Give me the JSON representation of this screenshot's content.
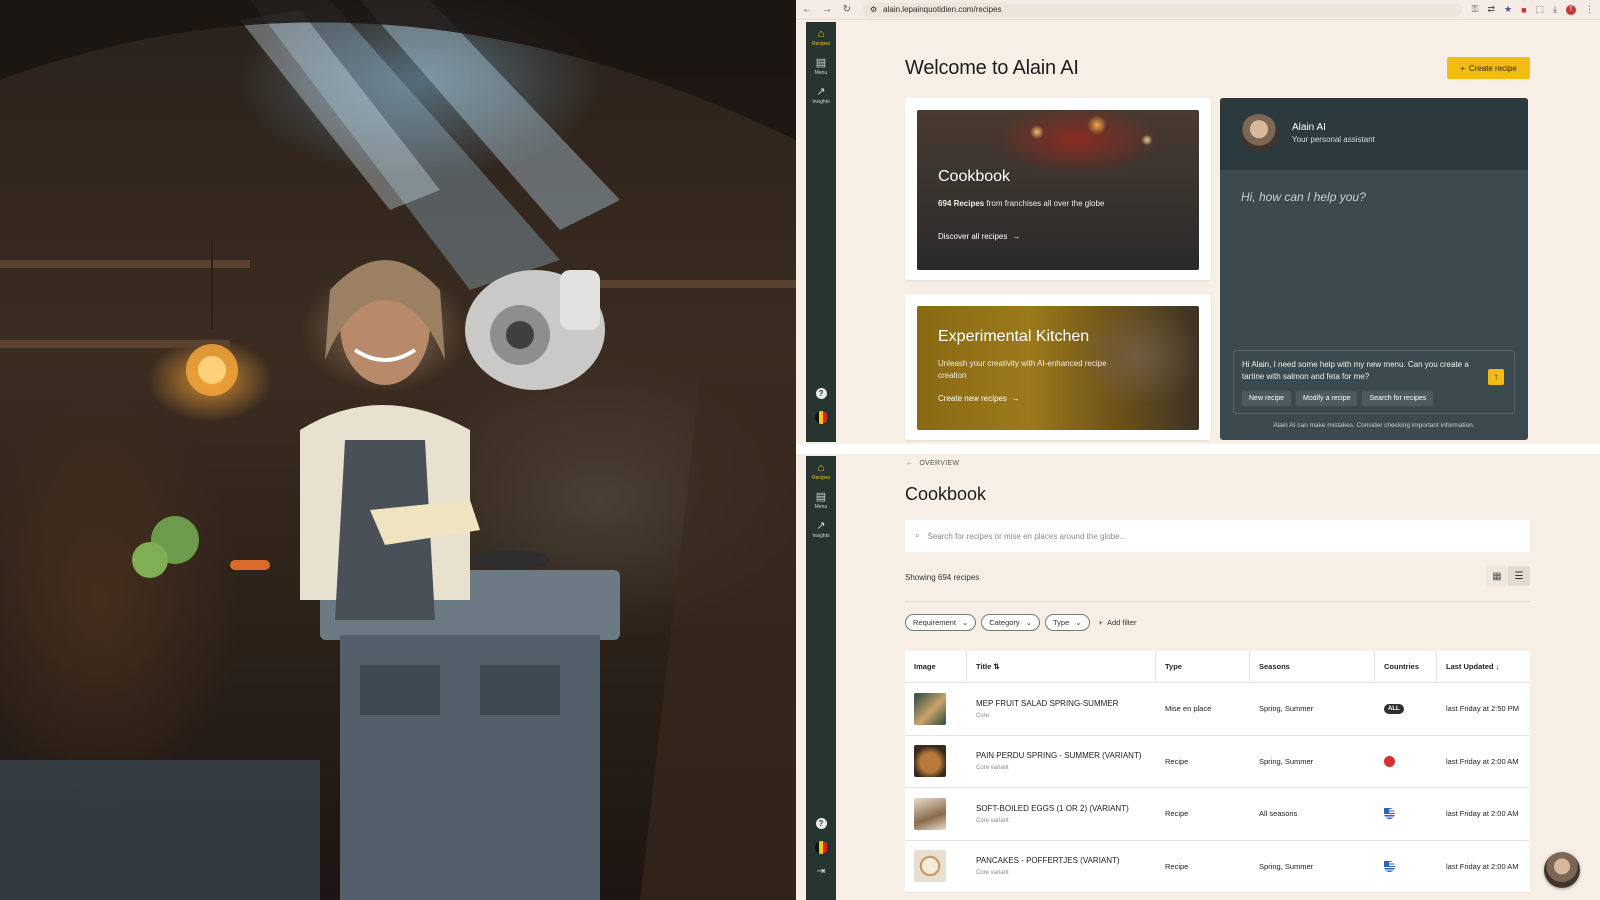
{
  "browser": {
    "url": "alain.lepainquotidien.com/recipes",
    "profile_initial": "T"
  },
  "sidebar": {
    "items": [
      {
        "label": "Recipes",
        "icon": "home-icon"
      },
      {
        "label": "Menu",
        "icon": "book-icon"
      },
      {
        "label": "Insights",
        "icon": "trend-icon"
      }
    ]
  },
  "welcome": {
    "title": "Welcome to Alain AI",
    "create_label": "Create recipe"
  },
  "cookbook_card": {
    "title": "Cookbook",
    "count": "694 Recipes",
    "text": "from franchises all over the globe",
    "link": "Discover all recipes"
  },
  "kitchen_card": {
    "title": "Experimental Kitchen",
    "text": "Unleash your creativity with AI-enhanced recipe creation",
    "link": "Create new recipes"
  },
  "assistant": {
    "name": "Alain AI",
    "subtitle": "Your personal assistant",
    "greeting": "Hi, how can I help you?",
    "prompt": "Hi Alain, I need some help with my new menu. Can you create a tartine with salmon and feta for me?",
    "chips": [
      "New recipe",
      "Modify a recipe",
      "Search for recipes"
    ],
    "disclaimer": "Alain AI can make mistakes. Consider checking important information."
  },
  "cookbook_page": {
    "breadcrumb": "OVERVIEW",
    "title": "Cookbook",
    "search_placeholder": "Search for recipes or mise en places around the globe...",
    "showing": "Showing 694 recipes",
    "filters": [
      "Requirement",
      "Category",
      "Type"
    ],
    "add_filter": "Add filter",
    "columns": {
      "image": "Image",
      "title": "Title",
      "type": "Type",
      "seasons": "Seasons",
      "countries": "Countries",
      "updated": "Last Updated"
    },
    "rows": [
      {
        "title": "MEP FRUIT SALAD SPRING-SUMMER",
        "sub": "Core",
        "type": "Mise en place",
        "seasons": "Spring, Summer",
        "country": "ALL",
        "updated": "last Friday at 2:50 PM"
      },
      {
        "title": "PAIN PERDU SPRING - SUMMER (VARIANT)",
        "sub": "Core variant",
        "type": "Recipe",
        "seasons": "Spring, Summer",
        "country": "red-dot",
        "updated": "last Friday at 2:00 AM"
      },
      {
        "title": "SOFT-BOILED EGGS (1 OR 2) (VARIANT)",
        "sub": "Core variant",
        "type": "Recipe",
        "seasons": "All seasons",
        "country": "greece-flag",
        "updated": "last Friday at 2:00 AM"
      },
      {
        "title": "PANCAKES - POFFERTJES (VARIANT)",
        "sub": "Core variant",
        "type": "Recipe",
        "seasons": "Spring, Summer",
        "country": "greece-flag",
        "updated": "last Friday at 2:00 AM"
      }
    ]
  },
  "colors": {
    "accent": "#f2bc12",
    "sidebar": "#263530",
    "assistant_bg": "#3a4a4e",
    "page_bg": "#f7efe6"
  }
}
